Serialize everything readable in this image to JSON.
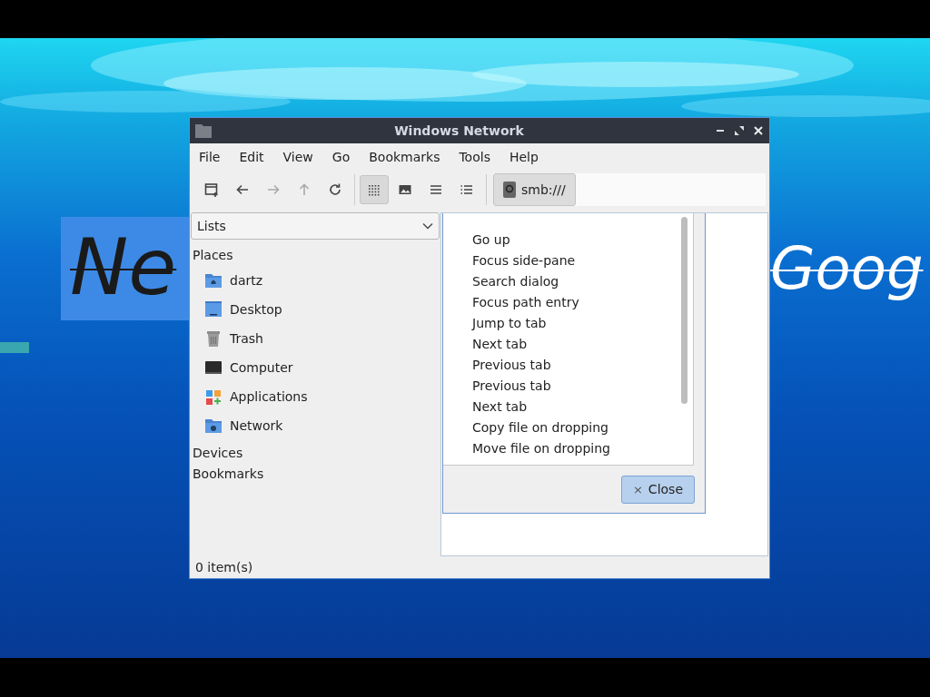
{
  "desktop": {
    "left_text": "Ne",
    "right_text": "Goog"
  },
  "window": {
    "title": "Windows Network"
  },
  "menu": [
    "File",
    "Edit",
    "View",
    "Go",
    "Bookmarks",
    "Tools",
    "Help"
  ],
  "toolbar": [
    {
      "kind": "new-tab",
      "disabled": false,
      "selected": false
    },
    {
      "kind": "back",
      "disabled": false,
      "selected": false
    },
    {
      "kind": "forward",
      "disabled": true,
      "selected": false
    },
    {
      "kind": "up",
      "disabled": true,
      "selected": false
    },
    {
      "kind": "reload",
      "disabled": false,
      "selected": false
    },
    {
      "kind": "icons",
      "disabled": false,
      "selected": true
    },
    {
      "kind": "thumbnails",
      "disabled": false,
      "selected": false
    },
    {
      "kind": "compact",
      "disabled": false,
      "selected": false
    },
    {
      "kind": "details",
      "disabled": false,
      "selected": false
    }
  ],
  "path": "smb:///",
  "side_pane": {
    "mode": "Lists",
    "sections": [
      {
        "label": "Places",
        "items": [
          {
            "label": "dartz",
            "kind": "home"
          },
          {
            "label": "Desktop",
            "kind": "desktop"
          },
          {
            "label": "Trash",
            "kind": "trash"
          },
          {
            "label": "Computer",
            "kind": "computer"
          },
          {
            "label": "Applications",
            "kind": "apps"
          },
          {
            "label": "Network",
            "kind": "network"
          }
        ]
      },
      {
        "label": "Devices"
      },
      {
        "label": "Bookmarks"
      }
    ]
  },
  "dialog": {
    "items": [
      "Go up",
      "Focus side-pane",
      "Search dialog",
      "Focus path entry",
      "Jump to tab",
      "Next tab",
      "Previous tab",
      "Previous tab",
      "Next tab",
      "Copy file on dropping",
      "Move file on dropping"
    ],
    "close_button": {
      "icon": "×",
      "label": "Close"
    }
  },
  "status_bar": "0 item(s)"
}
